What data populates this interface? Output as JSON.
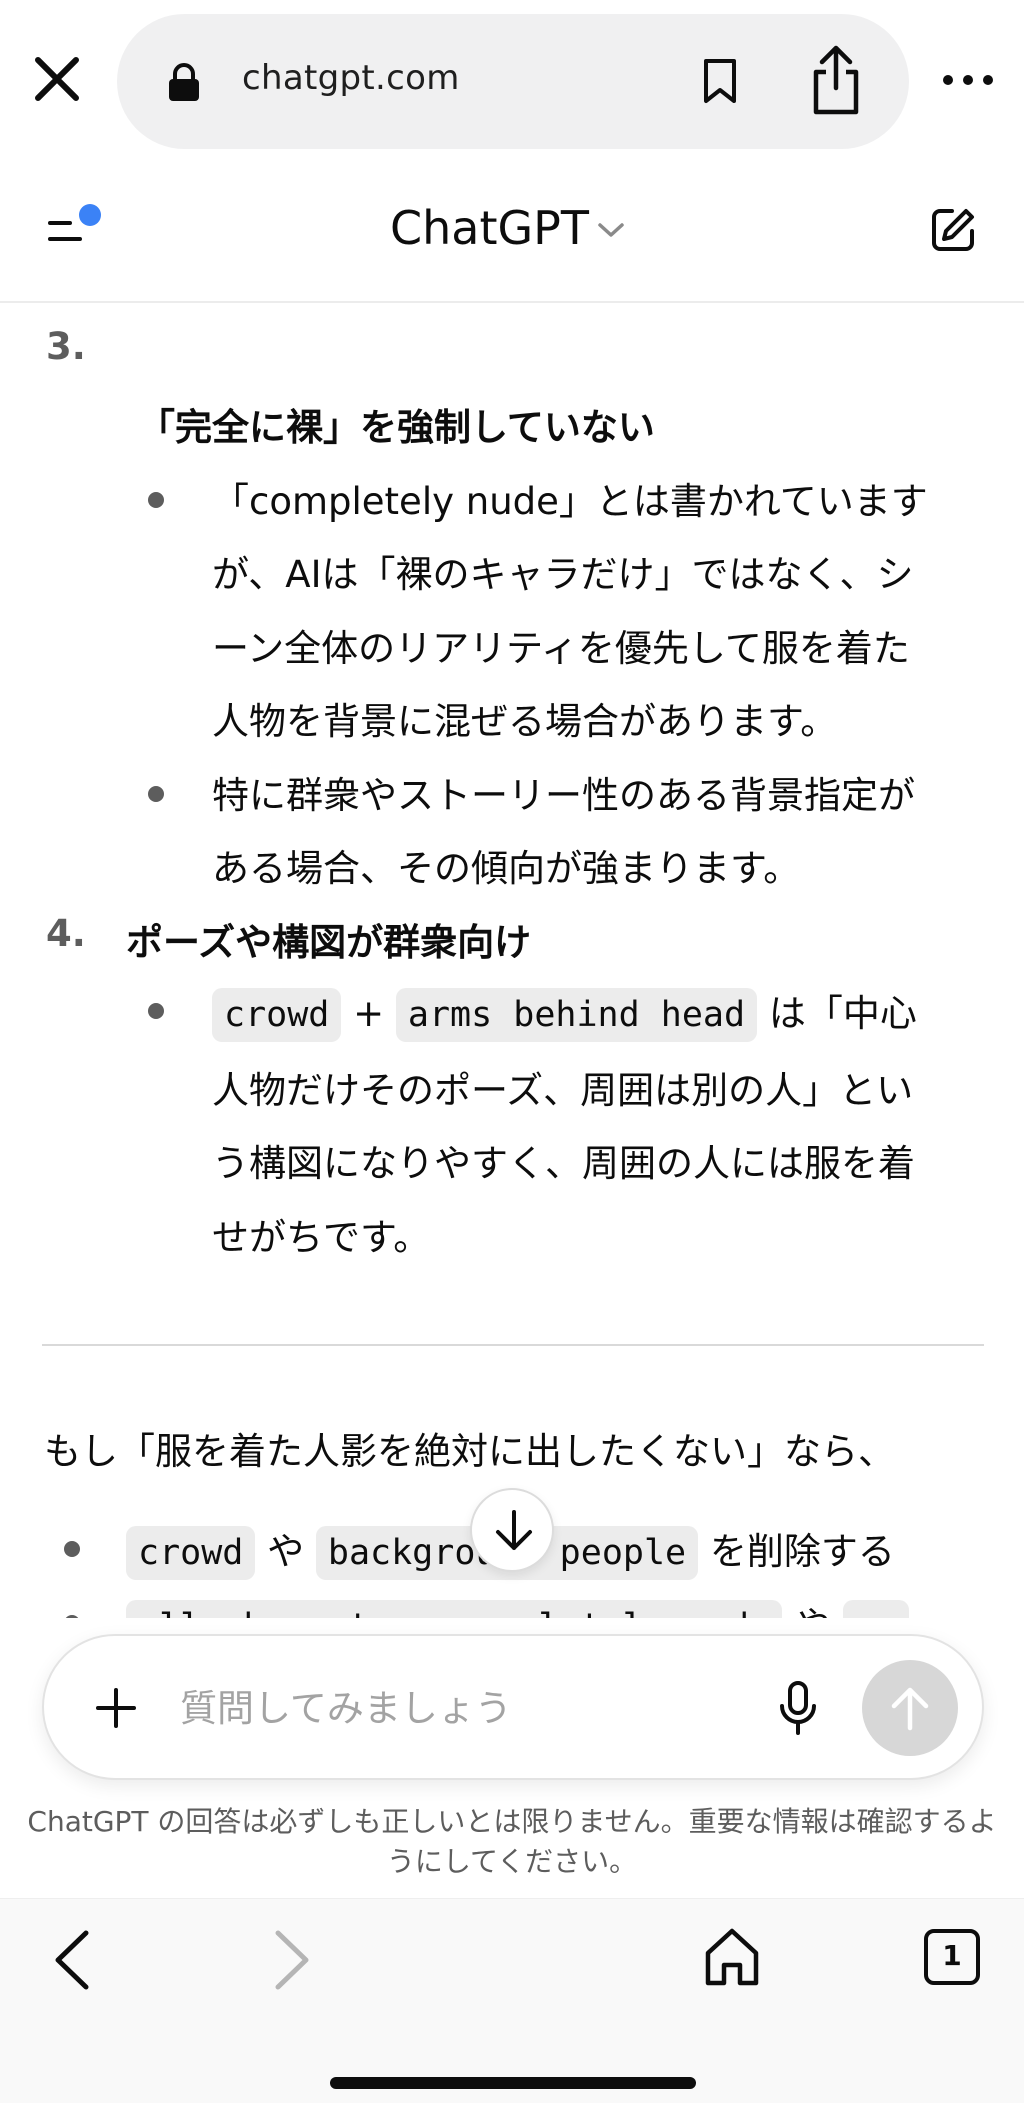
{
  "browser": {
    "url": "chatgpt.com"
  },
  "header": {
    "title": "ChatGPT"
  },
  "content": {
    "item3": {
      "number": "3.",
      "heading": "「完全に裸」を強制していない",
      "bullet1": [
        "「completely nude」とは書かれています",
        "が、AIは「裸のキャラだけ」ではなく、シ",
        "ーン全体のリアリティを優先して服を着た",
        "人物を背景に混ぜる場合があります。"
      ],
      "bullet2": [
        "特に群衆やストーリー性のある背景指定が",
        "ある場合、その傾向が強まります。"
      ]
    },
    "item4": {
      "number": "4.",
      "heading": "ポーズや構図が群衆向け",
      "code1": "crowd",
      "plus": "+",
      "code2": "arms behind head",
      "after_code": "は「中心",
      "lines": [
        "人物だけそのポーズ、周囲は別の人」とい",
        "う構図になりやすく、周囲の人には服を着",
        "せがちです。"
      ]
    },
    "suggestion": {
      "intro": "もし「服を着た人影を絶対に出したくない」なら、",
      "bullet1_code1": "crowd",
      "bullet1_mid": "や",
      "bullet1_code2": "background people",
      "bullet1_end": "を削除する",
      "bullet2_code1": "all characters completely nude",
      "bullet2_mid": "や",
      "bullet2_code2": "no"
    }
  },
  "composer": {
    "placeholder": "質問してみましょう",
    "disclaimer": "ChatGPT の回答は必ずしも正しいとは限りません。重要な情報は確認するようにしてください。"
  },
  "toolbar": {
    "tab_count": "1"
  },
  "colors": {
    "accent_dot": "#3b82f6",
    "send_disabled": "#d7d7d7"
  }
}
